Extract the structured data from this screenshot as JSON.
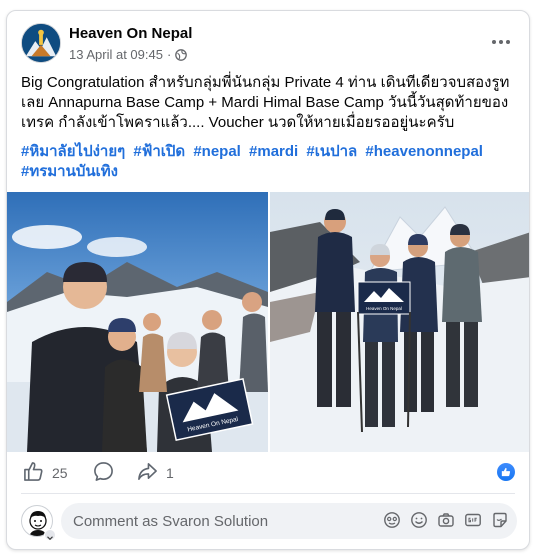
{
  "post": {
    "page_name": "Heaven On Nepal",
    "timestamp": "13 April at 09:45",
    "separator": "·",
    "body_lines": [
      "Big Congratulation สำหรับกลุ่มพี่นันกลุ่ม Private 4 ท่าน เดินทีเดียวจบสองรูท",
      "เลย Annapurna Base Camp + Mardi Himal Base Camp วันนี้วันสุดท้ายของ",
      "เทรค กำลังเข้าโพคราแล้ว.... Voucher นวดให้หายเมื่อยรออยู่นะครับ"
    ],
    "hashtags": [
      "#หิมาลัยไปง่ายๆ",
      "#ฟ้าเปิด",
      "#nepal",
      "#mardi",
      "#เนปาล",
      "#heavenonnepal",
      "#ทรมานบันเทิง"
    ],
    "photos": {
      "left_sign_text": "Heaven On Nepal",
      "right_sign_text": "Heaven On Nepal"
    }
  },
  "stats": {
    "likes": "25",
    "shares": "1"
  },
  "comment": {
    "placeholder": "Comment as Svaron Solution"
  },
  "icons": [
    "globe-icon",
    "more-icon",
    "like-icon",
    "comment-icon",
    "share-icon",
    "like-badge-icon",
    "avatar-icon",
    "emoji-icon",
    "sticker-icon",
    "camera-icon",
    "gif-icon",
    "gift-sticker-icon"
  ],
  "colors": {
    "link_blue": "#216fdb",
    "facebook_blue": "#1877f2",
    "muted_text": "#65676b",
    "comment_bg": "#f0f2f5"
  }
}
